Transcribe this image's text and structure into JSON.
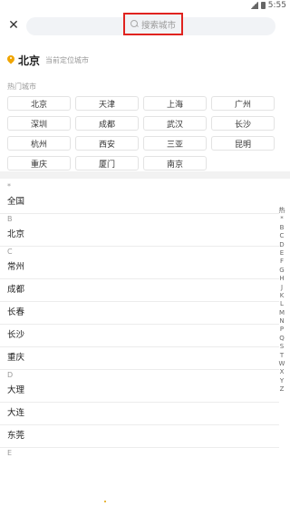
{
  "status": {
    "time": "5:55"
  },
  "search": {
    "placeholder": "搜索城市"
  },
  "location": {
    "city": "北京",
    "hint": "当前定位城市"
  },
  "hot": {
    "title": "热门城市",
    "cities": [
      "北京",
      "天津",
      "上海",
      "广州",
      "深圳",
      "成都",
      "武汉",
      "长沙",
      "杭州",
      "西安",
      "三亚",
      "昆明",
      "重庆",
      "厦门",
      "南京"
    ]
  },
  "sections": [
    {
      "letter": "*",
      "cities": [
        "全国"
      ]
    },
    {
      "letter": "B",
      "cities": [
        "北京"
      ]
    },
    {
      "letter": "C",
      "cities": [
        "常州",
        "成都",
        "长春",
        "长沙",
        "重庆"
      ]
    },
    {
      "letter": "D",
      "cities": [
        "大理",
        "大连",
        "东莞"
      ]
    },
    {
      "letter": "E",
      "cities": []
    }
  ],
  "index": [
    "热",
    "*",
    "B",
    "C",
    "D",
    "E",
    "F",
    "G",
    "H",
    "J",
    "K",
    "L",
    "M",
    "N",
    "P",
    "Q",
    "S",
    "T",
    "W",
    "X",
    "Y",
    "Z"
  ]
}
